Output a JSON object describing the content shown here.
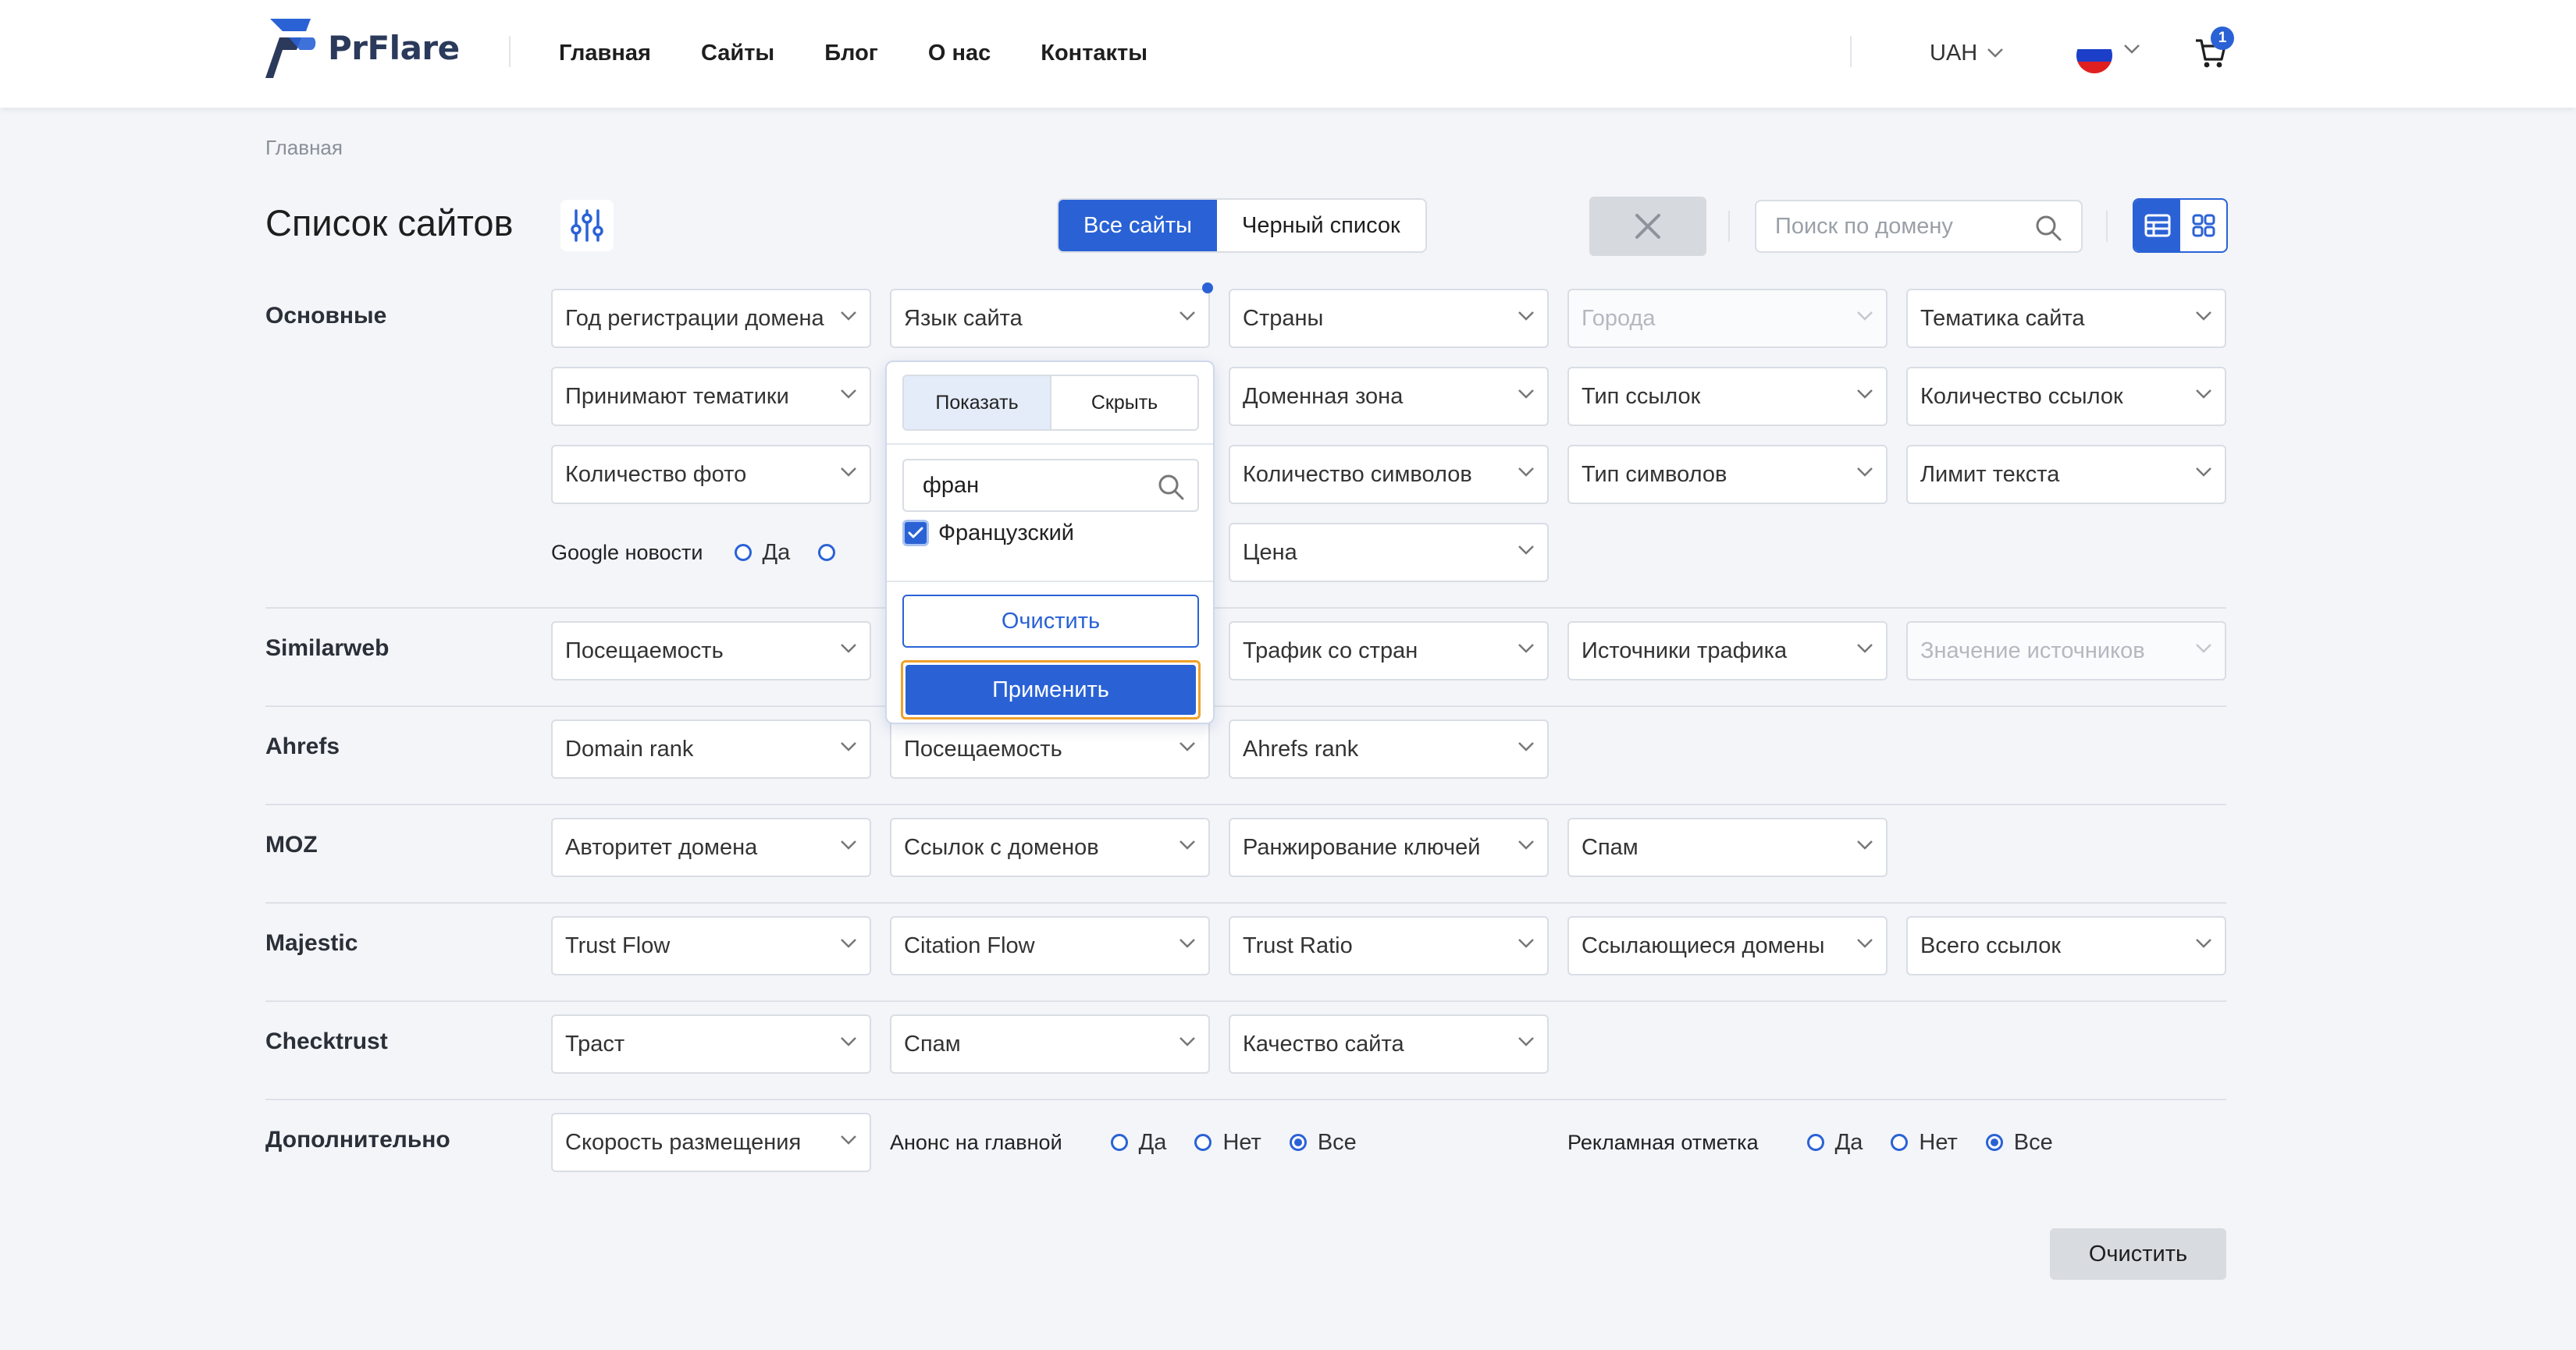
{
  "header": {
    "logo_text": "PrFlare",
    "nav": [
      "Главная",
      "Сайты",
      "Блог",
      "О нас",
      "Контакты"
    ],
    "currency": "UAH",
    "cart_count": "1"
  },
  "breadcrumb": "Главная",
  "page_title": "Список сайтов",
  "tabs": {
    "all": "Все сайты",
    "blacklist": "Черный список"
  },
  "search": {
    "placeholder": "Поиск по домену"
  },
  "sections": {
    "main": "Основные",
    "similarweb": "Similarweb",
    "ahrefs": "Ahrefs",
    "moz": "MOZ",
    "majestic": "Majestic",
    "checktrust": "Checktrust",
    "extra": "Дополнительно"
  },
  "filters": {
    "reg_year": "Год регистрации домена",
    "site_lang": "Язык сайта",
    "countries": "Страны",
    "cities": "Города",
    "topic": "Тематика сайта",
    "accept_topics": "Принимают тематики",
    "domain_zone": "Доменная зона",
    "link_type": "Тип ссылок",
    "link_count": "Количество ссылок",
    "photo_count": "Количество фото",
    "char_count": "Количество символов",
    "char_type": "Тип символов",
    "text_limit": "Лимит текста",
    "price": "Цена",
    "sw_traffic": "Посещаемость",
    "sw_country_traffic": "Трафик со стран",
    "sw_sources": "Источники трафика",
    "sw_source_value": "Значение источников",
    "ah_domain_rank": "Domain rank",
    "ah_traffic": "Посещаемость",
    "ah_rank": "Ahrefs rank",
    "moz_authority": "Авторитет домена",
    "moz_links": "Ссылок с доменов",
    "moz_keywords": "Ранжирование ключей",
    "moz_spam": "Спам",
    "mj_trust_flow": "Trust Flow",
    "mj_citation_flow": "Citation Flow",
    "mj_trust_ratio": "Trust Ratio",
    "mj_ref_domains": "Ссылающиеся домены",
    "mj_total_links": "Всего ссылок",
    "ct_trust": "Траст",
    "ct_spam": "Спам",
    "ct_quality": "Качество сайта",
    "ex_speed": "Скорость размещения"
  },
  "radios": {
    "google_news": {
      "label": "Google новости",
      "yes": "Да"
    },
    "announce": {
      "label": "Анонс на главной",
      "yes": "Да",
      "no": "Нет",
      "all": "Все",
      "selected": "all"
    },
    "ad_mark": {
      "label": "Рекламная отметка",
      "yes": "Да",
      "no": "Нет",
      "all": "Все",
      "selected": "all"
    }
  },
  "dropdown": {
    "show": "Показать",
    "hide": "Скрыть",
    "search_value": "фран",
    "option": "Французский",
    "option_checked": true,
    "clear": "Очистить",
    "apply": "Применить"
  },
  "clear_all": "Очистить",
  "colors": {
    "accent": "#2a62d6",
    "focus_ring": "#f0a12b",
    "brand_dark": "#2b3a5b"
  }
}
